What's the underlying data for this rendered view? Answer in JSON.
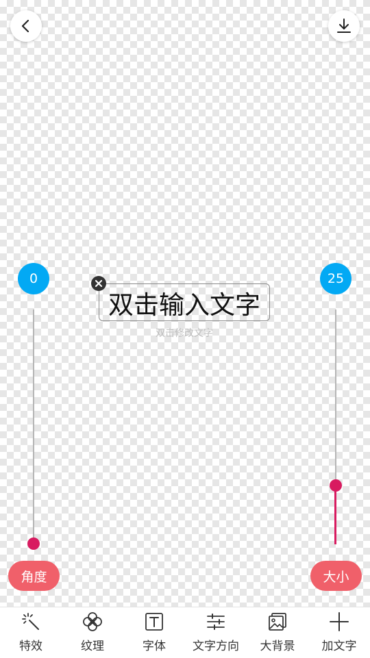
{
  "top": {
    "back_icon": "chevron-left-icon",
    "download_icon": "download-icon"
  },
  "angle": {
    "value": "0",
    "label": "角度",
    "level": 0
  },
  "size": {
    "value": "25",
    "label": "大小",
    "level": 0.25
  },
  "text_layer": {
    "text": "双击输入文字",
    "hint": "双击修改文字",
    "remove_icon": "close-icon"
  },
  "toolbar": {
    "items": [
      {
        "label": "特效",
        "icon": "magic-wand-icon"
      },
      {
        "label": "纹理",
        "icon": "flower-icon"
      },
      {
        "label": "字体",
        "icon": "text-box-icon"
      },
      {
        "label": "文字方向",
        "icon": "sliders-icon"
      },
      {
        "label": "大背景",
        "icon": "image-icon"
      },
      {
        "label": "加文字",
        "icon": "plus-icon"
      }
    ]
  },
  "colors": {
    "accent_blue": "#03a9f4",
    "slider_pink": "#d81b60",
    "pill_red": "#f0606a"
  }
}
